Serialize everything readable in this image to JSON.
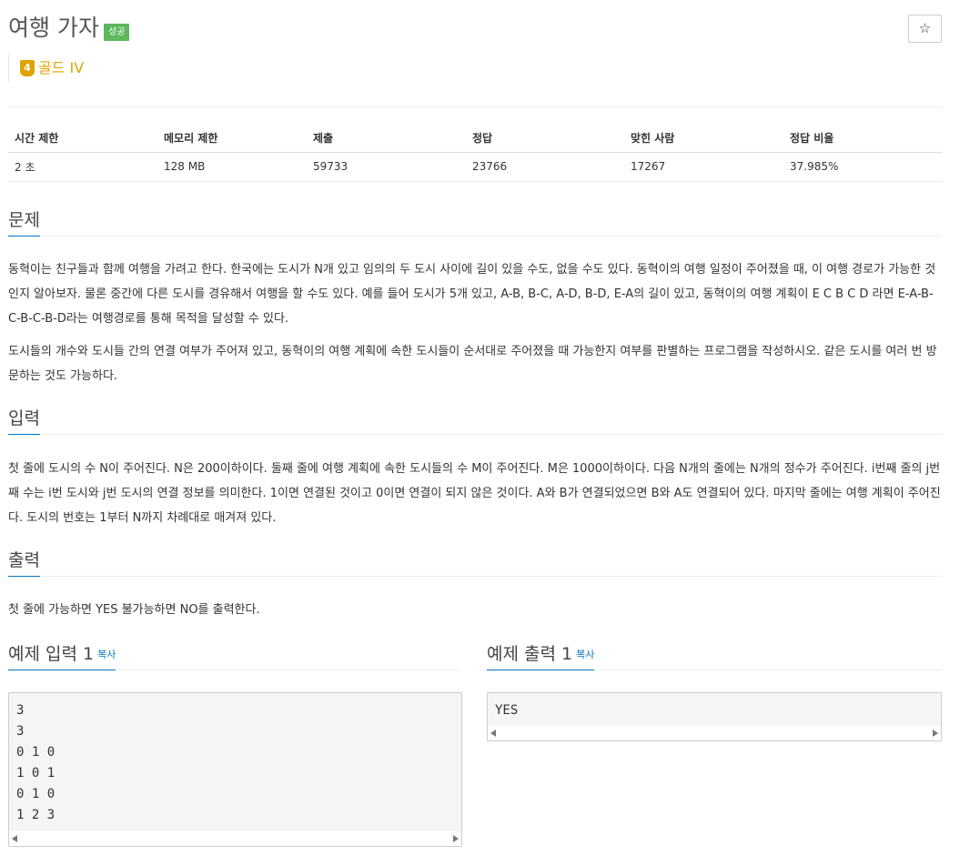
{
  "problem": {
    "title": "여행 가자",
    "status_badge": "성공",
    "star_icon": "☆",
    "tier_number": "4",
    "tier_label": "골드 IV"
  },
  "stats": {
    "headers": [
      "시간 제한",
      "메모리 제한",
      "제출",
      "정답",
      "맞힌 사람",
      "정답 비율"
    ],
    "values": [
      "2 초",
      "128 MB",
      "59733",
      "23766",
      "17267",
      "37.985%"
    ]
  },
  "sections": {
    "problem_title": "문제",
    "problem_text_1": "동혁이는 친구들과 함께 여행을 가려고 한다. 한국에는 도시가 N개 있고 임의의 두 도시 사이에 길이 있을 수도, 없을 수도 있다. 동혁이의 여행 일정이 주어졌을 때, 이 여행 경로가 가능한 것인지 알아보자. 물론 중간에 다른 도시를 경유해서 여행을 할 수도 있다. 예를 들어 도시가 5개 있고, A-B, B-C, A-D, B-D, E-A의 길이 있고, 동혁이의 여행 계획이 E C B C D 라면 E-A-B-C-B-C-B-D라는 여행경로를 통해 목적을 달성할 수 있다.",
    "problem_text_2": "도시들의 개수와 도시들 간의 연결 여부가 주어져 있고, 동혁이의 여행 계획에 속한 도시들이 순서대로 주어졌을 때 가능한지 여부를 판별하는 프로그램을 작성하시오. 같은 도시를 여러 번 방문하는 것도 가능하다.",
    "input_title": "입력",
    "input_text": "첫 줄에 도시의 수 N이 주어진다. N은 200이하이다. 둘째 줄에 여행 계획에 속한 도시들의 수 M이 주어진다. M은 1000이하이다. 다음 N개의 줄에는 N개의 정수가 주어진다. i번째 줄의 j번째 수는 i번 도시와 j번 도시의 연결 정보를 의미한다. 1이면 연결된 것이고 0이면 연결이 되지 않은 것이다. A와 B가 연결되었으면 B와 A도 연결되어 있다. 마지막 줄에는 여행 계획이 주어진다. 도시의 번호는 1부터 N까지 차례대로 매겨져 있다.",
    "output_title": "출력",
    "output_text": "첫 줄에 가능하면 YES 불가능하면 NO를 출력한다.",
    "sample_input_title": "예제 입력 1",
    "sample_output_title": "예제 출력 1",
    "copy_label": "복사",
    "sample_input": "3\n3\n0 1 0\n1 0 1\n0 1 0\n1 2 3",
    "sample_output": "YES"
  },
  "colors": {
    "success": "#5cb85c",
    "gold": "#e0a400",
    "link": "#0076c0"
  }
}
